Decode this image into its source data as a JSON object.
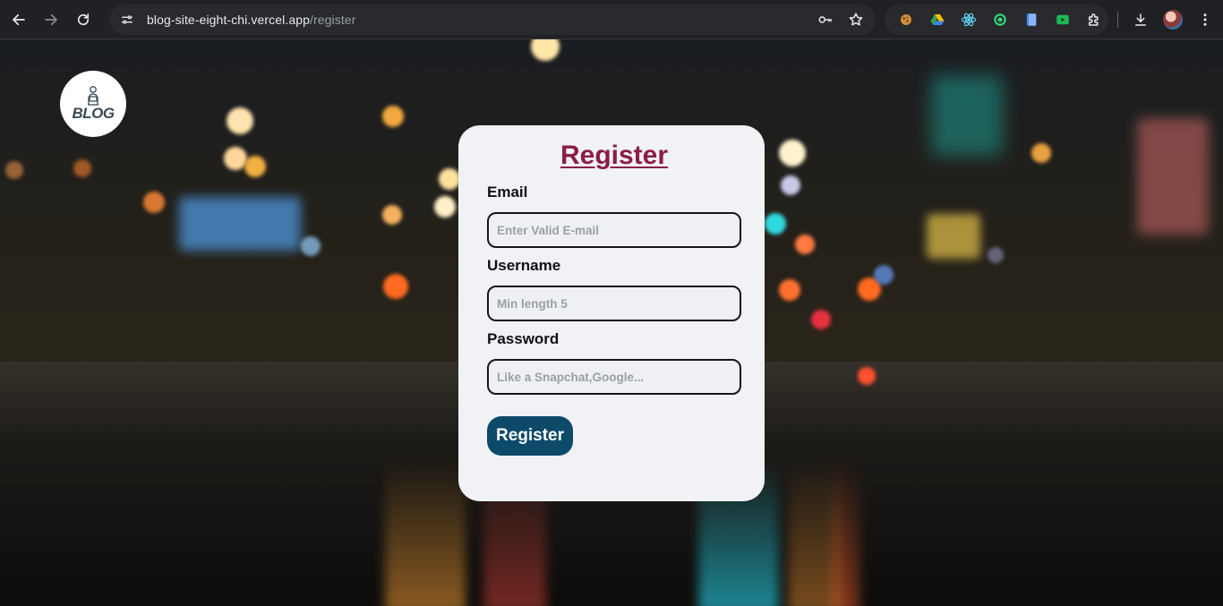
{
  "browser": {
    "url_host": "blog-site-eight-chi.vercel.app",
    "url_path": "/register",
    "icons": {
      "back": "back-arrow-icon",
      "forward": "forward-arrow-icon",
      "reload": "reload-icon",
      "site_info": "site-info-icon",
      "password": "key-icon",
      "bookmark": "star-icon",
      "download": "download-icon",
      "menu": "more-vertical-icon"
    },
    "extensions": [
      "cookie-extension-icon",
      "drive-extension-icon",
      "react-devtools-icon",
      "target-extension-icon",
      "docs-extension-icon",
      "video-extension-icon",
      "puzzle-extensions-icon"
    ]
  },
  "logo": {
    "text": "BLOG"
  },
  "form": {
    "title": "Register",
    "email_label": "Email",
    "email_placeholder": "Enter Valid E-mail",
    "username_label": "Username",
    "username_placeholder": "Min length 5",
    "password_label": "Password",
    "password_placeholder": "Like a Snapchat,Google...",
    "submit_label": "Register"
  },
  "colors": {
    "title": "#8b1d46",
    "button": "#0d4a6a",
    "card": "#f0f2f5"
  }
}
